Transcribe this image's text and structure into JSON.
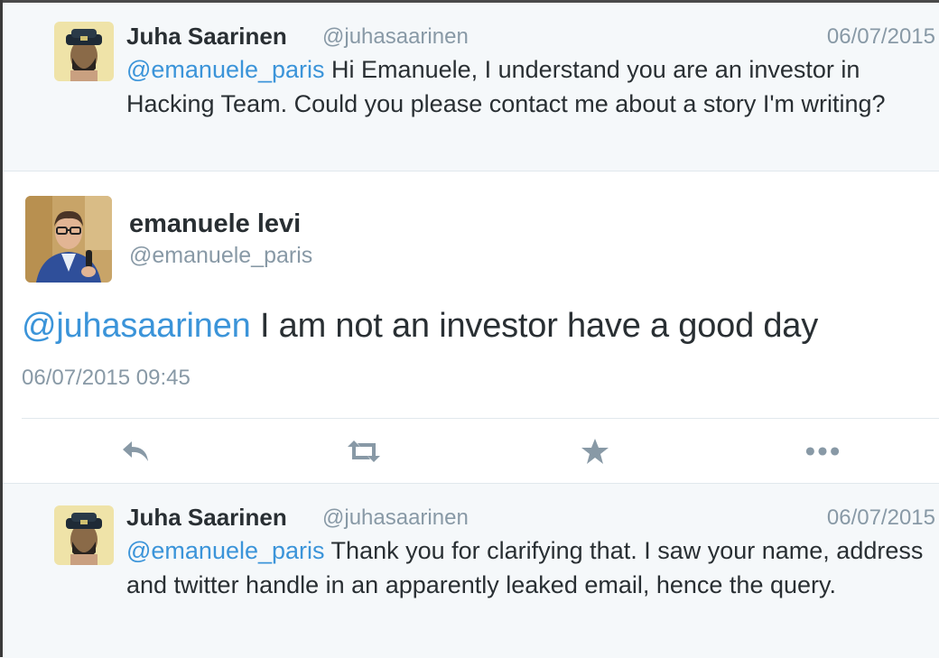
{
  "reply1": {
    "name": "Juha Saarinen",
    "handle": "@juhasaarinen",
    "date": "06/07/2015",
    "mention": "@emanuele_paris",
    "text": " Hi Emanuele, I understand you are an investor in Hacking Team. Could you please contact me about a story I'm writing?"
  },
  "main": {
    "name": "emanuele levi",
    "handle": "@emanuele_paris",
    "mention": "@juhasaarinen",
    "text": " I am not an investor have a good day",
    "timestamp": "06/07/2015 09:45",
    "actions": [
      "reply-icon",
      "retweet-icon",
      "favorite-star-icon",
      "more-icon"
    ]
  },
  "reply2": {
    "name": "Juha Saarinen",
    "handle": "@juhasaarinen",
    "date": "06/07/2015",
    "mention": "@emanuele_paris",
    "text": " Thank you for clarifying that. I saw your name, address and twitter handle in an apparently leaked email, hence the query."
  },
  "colors": {
    "link": "#3b94d9",
    "muted": "#8899a6",
    "text": "#292f33",
    "reply_bg": "#f5f8fa",
    "divider": "#e1e8ed"
  }
}
